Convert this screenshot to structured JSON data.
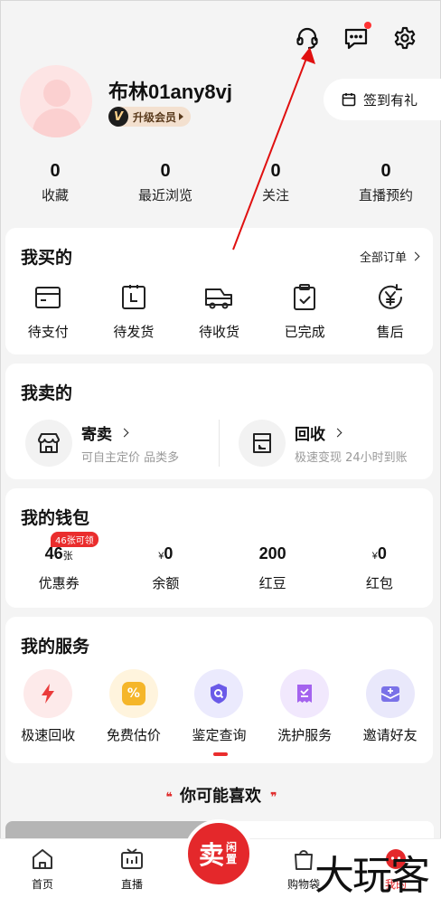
{
  "header": {
    "icons": [
      "customer-service-icon",
      "message-icon",
      "settings-icon"
    ]
  },
  "profile": {
    "username": "布林01any8vj",
    "member_label": "升级会员",
    "member_badge": "V",
    "checkin_label": "签到有礼"
  },
  "stats": [
    {
      "num": "0",
      "label": "收藏"
    },
    {
      "num": "0",
      "label": "最近浏览"
    },
    {
      "num": "0",
      "label": "关注"
    },
    {
      "num": "0",
      "label": "直播预约"
    }
  ],
  "buy": {
    "title": "我买的",
    "all_orders": "全部订单",
    "items": [
      {
        "label": "待支付",
        "icon": "wallet-icon"
      },
      {
        "label": "待发货",
        "icon": "clock-box-icon"
      },
      {
        "label": "待收货",
        "icon": "truck-icon"
      },
      {
        "label": "已完成",
        "icon": "clipboard-check-icon"
      },
      {
        "label": "售后",
        "icon": "yuan-refresh-icon"
      }
    ]
  },
  "sell": {
    "title": "我卖的",
    "items": [
      {
        "name": "寄卖",
        "desc": "可自主定价 品类多",
        "icon": "shop-icon"
      },
      {
        "name": "回收",
        "desc": "极速变现 24小时到账",
        "icon": "recycle-box-icon"
      }
    ]
  },
  "wallet": {
    "title": "我的钱包",
    "tag": "46张可领",
    "items": [
      {
        "value": "46",
        "unit": "张",
        "prefix": "",
        "label": "优惠券"
      },
      {
        "value": "0",
        "unit": "",
        "prefix": "¥",
        "label": "余额"
      },
      {
        "value": "200",
        "unit": "",
        "prefix": "",
        "label": "红豆"
      },
      {
        "value": "0",
        "unit": "",
        "prefix": "¥",
        "label": "红包"
      }
    ]
  },
  "services": {
    "title": "我的服务",
    "items": [
      {
        "label": "极速回收",
        "icon": "lightning-icon",
        "bg": "#fdeaea",
        "fg": "#ea3b3b"
      },
      {
        "label": "免费估价",
        "icon": "percent-icon",
        "bg": "#fff4dd",
        "fg": "#f5b62a"
      },
      {
        "label": "鉴定查询",
        "icon": "shield-search-icon",
        "bg": "#ebeafd",
        "fg": "#6a5ae8"
      },
      {
        "label": "洗护服务",
        "icon": "receipt-icon",
        "bg": "#f1e8fd",
        "fg": "#a463ee"
      },
      {
        "label": "邀请好友",
        "icon": "invite-mail-icon",
        "bg": "#e9e8fb",
        "fg": "#7a72e8"
      }
    ]
  },
  "recommend": {
    "title": "你可能喜欢"
  },
  "tabbar": {
    "tabs": [
      {
        "label": "首页",
        "icon": "home-icon"
      },
      {
        "label": "直播",
        "icon": "tv-icon"
      },
      {
        "label": "购物袋",
        "icon": "bag-icon"
      },
      {
        "label": "我的",
        "icon": "me-icon"
      }
    ],
    "sell_big": "卖",
    "sell_small": "闲置",
    "watermark": "大玩客"
  },
  "colors": {
    "accent": "#e4282b",
    "background": "#f4f4f4"
  }
}
